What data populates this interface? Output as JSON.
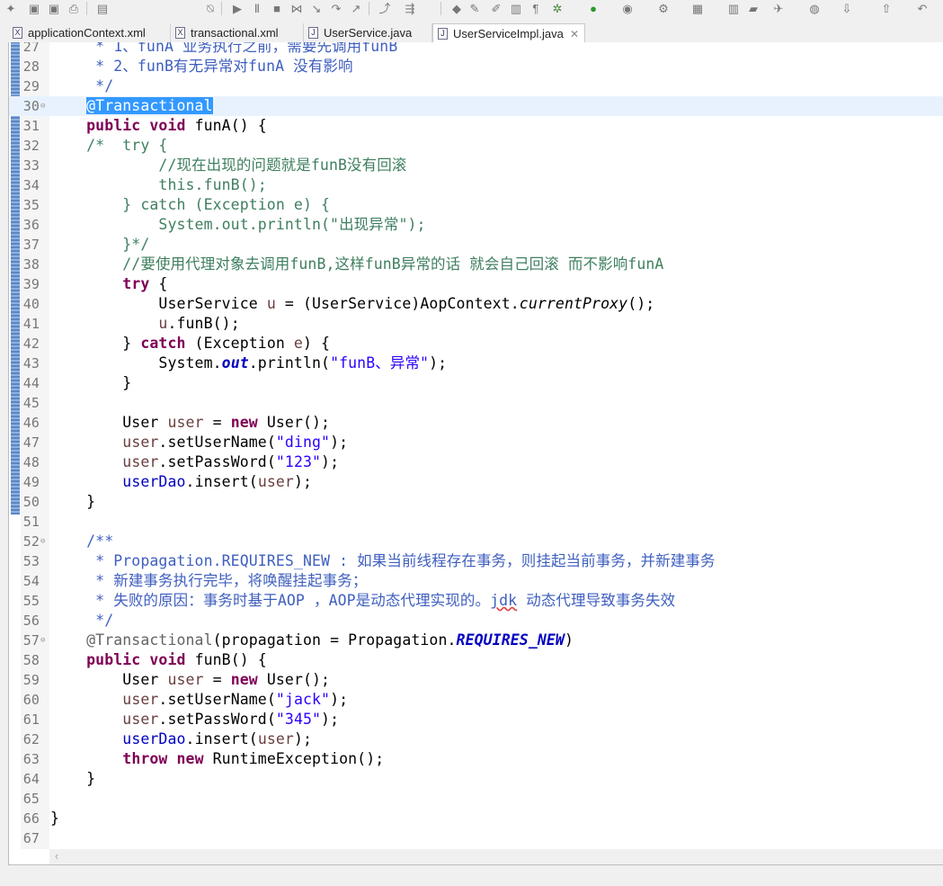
{
  "toolbar": {
    "icons": [
      "new-wizard-icon",
      "save-icon",
      "save-all-icon",
      "print-icon",
      "binary-icon",
      "skip-breakpoints-icon",
      "resume-icon",
      "suspend-icon",
      "terminate-icon",
      "disconnect-icon",
      "step-into-icon",
      "step-over-icon",
      "step-return-icon",
      "drop-to-frame-icon",
      "use-step-filters-icon",
      "open-type-icon",
      "toggle-mark-occurrences-icon",
      "toggle-breadcrumb-icon",
      "block-selection-icon",
      "show-whitespace-icon",
      "debug-icon",
      "run-icon",
      "coverage-icon",
      "external-tools-icon",
      "new-java-project-icon",
      "new-package-icon",
      "open-folder-icon",
      "search-icon",
      "globe-icon",
      "next-annotation-icon",
      "prev-annotation-icon",
      "back-icon"
    ]
  },
  "tabs": [
    {
      "label": "applicationContext.xml",
      "icon": "xml-file-icon",
      "active": false
    },
    {
      "label": "transactional.xml",
      "icon": "xml-file-icon",
      "active": false
    },
    {
      "label": "UserService.java",
      "icon": "java-file-icon",
      "active": false
    },
    {
      "label": "UserServiceImpl.java",
      "icon": "java-file-icon",
      "active": true,
      "close": "✕"
    }
  ],
  "editor": {
    "lines": [
      {
        "n": "27",
        "t": [
          [
            "jd",
            "     * 1、funA 业务执行之前，需要先调用funB"
          ]
        ]
      },
      {
        "n": "28",
        "t": [
          [
            "jd",
            "     * 2、funB有无异常对funA 没有影响"
          ]
        ]
      },
      {
        "n": "29",
        "t": [
          [
            "jd",
            "     */"
          ]
        ]
      },
      {
        "n": "30",
        "fold": "⊖",
        "cur": true,
        "t": [
          [
            "pl",
            "    "
          ],
          [
            "sel",
            "@Transactional"
          ]
        ]
      },
      {
        "n": "31",
        "t": [
          [
            "pl",
            "    "
          ],
          [
            "kw",
            "public"
          ],
          [
            "pl",
            " "
          ],
          [
            "kw",
            "void"
          ],
          [
            "pl",
            " funA() {"
          ]
        ]
      },
      {
        "n": "32",
        "t": [
          [
            "cm",
            "    /*  try {"
          ]
        ]
      },
      {
        "n": "33",
        "t": [
          [
            "cm",
            "            //现在出现的问题就是funB没有回滚"
          ]
        ]
      },
      {
        "n": "34",
        "t": [
          [
            "cm",
            "            this.funB();"
          ]
        ]
      },
      {
        "n": "35",
        "t": [
          [
            "cm",
            "        } catch (Exception e) {"
          ]
        ]
      },
      {
        "n": "36",
        "t": [
          [
            "cm",
            "            System.out.println(\"出现异常\");"
          ]
        ]
      },
      {
        "n": "37",
        "t": [
          [
            "cm",
            "        }*/"
          ]
        ]
      },
      {
        "n": "38",
        "t": [
          [
            "cm",
            "        //要使用代理对象去调用funB,这样funB异常的话 就会自己回滚 而不影响funA"
          ]
        ]
      },
      {
        "n": "39",
        "t": [
          [
            "pl",
            "        "
          ],
          [
            "kw",
            "try"
          ],
          [
            "pl",
            " {"
          ]
        ]
      },
      {
        "n": "40",
        "t": [
          [
            "pl",
            "            UserService "
          ],
          [
            "lv",
            "u"
          ],
          [
            "pl",
            " = (UserService)AopContext."
          ],
          [
            "it",
            "currentProxy"
          ],
          [
            "pl",
            "();"
          ]
        ]
      },
      {
        "n": "41",
        "t": [
          [
            "pl",
            "            "
          ],
          [
            "lv",
            "u"
          ],
          [
            "pl",
            ".funB();"
          ]
        ]
      },
      {
        "n": "42",
        "t": [
          [
            "pl",
            "        } "
          ],
          [
            "kw",
            "catch"
          ],
          [
            "pl",
            " (Exception "
          ],
          [
            "lv",
            "e"
          ],
          [
            "pl",
            ") {"
          ]
        ]
      },
      {
        "n": "43",
        "t": [
          [
            "pl",
            "            System."
          ],
          [
            "sf",
            "out"
          ],
          [
            "pl",
            ".println("
          ],
          [
            "st",
            "\"funB、异常\""
          ],
          [
            "pl",
            ");"
          ]
        ]
      },
      {
        "n": "44",
        "t": [
          [
            "pl",
            "        }"
          ]
        ]
      },
      {
        "n": "45",
        "t": []
      },
      {
        "n": "46",
        "t": [
          [
            "pl",
            "        User "
          ],
          [
            "lv",
            "user"
          ],
          [
            "pl",
            " = "
          ],
          [
            "kw",
            "new"
          ],
          [
            "pl",
            " User();"
          ]
        ]
      },
      {
        "n": "47",
        "t": [
          [
            "pl",
            "        "
          ],
          [
            "lv",
            "user"
          ],
          [
            "pl",
            ".setUserName("
          ],
          [
            "st",
            "\"ding\""
          ],
          [
            "pl",
            ");"
          ]
        ]
      },
      {
        "n": "48",
        "t": [
          [
            "pl",
            "        "
          ],
          [
            "lv",
            "user"
          ],
          [
            "pl",
            ".setPassWord("
          ],
          [
            "st",
            "\"123\""
          ],
          [
            "pl",
            ");"
          ]
        ]
      },
      {
        "n": "49",
        "t": [
          [
            "pl",
            "        "
          ],
          [
            "fd",
            "userDao"
          ],
          [
            "pl",
            ".insert("
          ],
          [
            "lv",
            "user"
          ],
          [
            "pl",
            ");"
          ]
        ]
      },
      {
        "n": "50",
        "t": [
          [
            "pl",
            "    }"
          ]
        ]
      },
      {
        "n": "51",
        "t": []
      },
      {
        "n": "52",
        "fold": "⊖",
        "t": [
          [
            "jd",
            "    /**"
          ]
        ]
      },
      {
        "n": "53",
        "t": [
          [
            "jd",
            "     * Propagation.REQUIRES_NEW : 如果当前线程存在事务，则挂起当前事务，并新建事务"
          ]
        ]
      },
      {
        "n": "54",
        "t": [
          [
            "jd",
            "     * 新建事务执行完毕，将唤醒挂起事务；"
          ]
        ]
      },
      {
        "n": "55",
        "t": [
          [
            "jd",
            "     * 失败的原因：事务时基于AOP ，AOP是动态代理实现的。"
          ],
          [
            "sp",
            "jdk"
          ],
          [
            "jd",
            " 动态代理导致事务失效"
          ]
        ]
      },
      {
        "n": "56",
        "t": [
          [
            "jd",
            "     */"
          ]
        ]
      },
      {
        "n": "57",
        "fold": "⊖",
        "t": [
          [
            "pl",
            "    "
          ],
          [
            "an",
            "@Transactional"
          ],
          [
            "pl",
            "(propagation = Propagation."
          ],
          [
            "sf",
            "REQUIRES_NEW"
          ],
          [
            "pl",
            ")"
          ]
        ]
      },
      {
        "n": "58",
        "t": [
          [
            "pl",
            "    "
          ],
          [
            "kw",
            "public"
          ],
          [
            "pl",
            " "
          ],
          [
            "kw",
            "void"
          ],
          [
            "pl",
            " funB() {"
          ]
        ]
      },
      {
        "n": "59",
        "t": [
          [
            "pl",
            "        User "
          ],
          [
            "lv",
            "user"
          ],
          [
            "pl",
            " = "
          ],
          [
            "kw",
            "new"
          ],
          [
            "pl",
            " User();"
          ]
        ]
      },
      {
        "n": "60",
        "t": [
          [
            "pl",
            "        "
          ],
          [
            "lv",
            "user"
          ],
          [
            "pl",
            ".setUserName("
          ],
          [
            "st",
            "\"jack\""
          ],
          [
            "pl",
            ");"
          ]
        ]
      },
      {
        "n": "61",
        "t": [
          [
            "pl",
            "        "
          ],
          [
            "lv",
            "user"
          ],
          [
            "pl",
            ".setPassWord("
          ],
          [
            "st",
            "\"345\""
          ],
          [
            "pl",
            ");"
          ]
        ]
      },
      {
        "n": "62",
        "t": [
          [
            "pl",
            "        "
          ],
          [
            "fd",
            "userDao"
          ],
          [
            "pl",
            ".insert("
          ],
          [
            "lv",
            "user"
          ],
          [
            "pl",
            ");"
          ]
        ]
      },
      {
        "n": "63",
        "t": [
          [
            "pl",
            "        "
          ],
          [
            "kw",
            "throw"
          ],
          [
            "pl",
            " "
          ],
          [
            "kw",
            "new"
          ],
          [
            "pl",
            " RuntimeException();"
          ]
        ]
      },
      {
        "n": "64",
        "t": [
          [
            "pl",
            "    }"
          ]
        ]
      },
      {
        "n": "65",
        "t": []
      },
      {
        "n": "66",
        "t": [
          [
            "pl",
            "}"
          ]
        ]
      },
      {
        "n": "67",
        "t": []
      }
    ]
  },
  "scroll_left": "‹"
}
